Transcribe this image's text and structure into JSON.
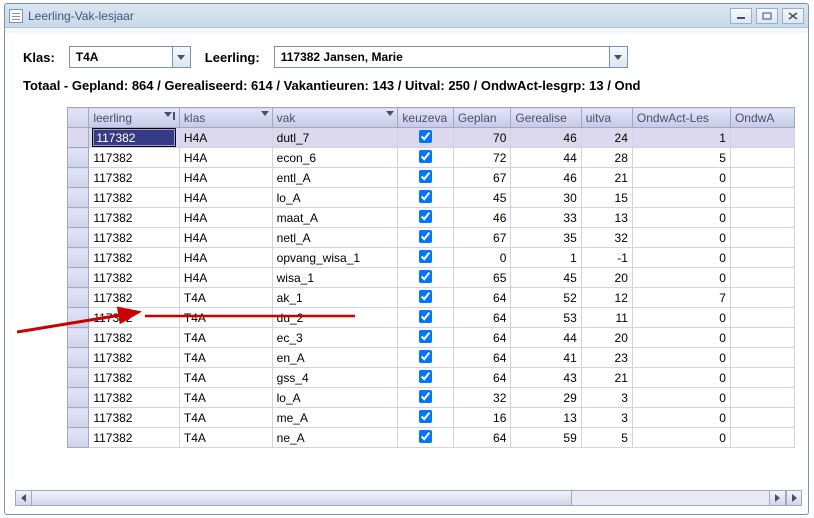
{
  "window": {
    "title": "Leerling-Vak-lesjaar"
  },
  "filters": {
    "klas_label": "Klas:",
    "klas_value": "T4A",
    "leerling_label": "Leerling:",
    "leerling_value": "117382 Jansen,  Marie"
  },
  "summary": "Totaal - Gepland: 864 / Gerealiseerd: 614 / Vakantieuren: 143 / Uitval: 250 / OndwAct-lesgrp: 13 / Ond",
  "columns": {
    "leerling": "leerling",
    "klas": "klas",
    "vak": "vak",
    "keuzeva": "keuzeva",
    "geplan": "Geplan",
    "gerealise": "Gerealise",
    "uitva": "uitva",
    "ondwact_les": "OndwAct-Les",
    "ondwa": "OndwA"
  },
  "rows": [
    {
      "leerling": "117382",
      "klas": "H4A",
      "vak": "dutl_7",
      "keuzeva": true,
      "geplan": "70",
      "gerealise": "46",
      "uitva": "24",
      "ondwact": "1",
      "ondwa": ""
    },
    {
      "leerling": "117382",
      "klas": "H4A",
      "vak": "econ_6",
      "keuzeva": true,
      "geplan": "72",
      "gerealise": "44",
      "uitva": "28",
      "ondwact": "5",
      "ondwa": ""
    },
    {
      "leerling": "117382",
      "klas": "H4A",
      "vak": "entl_A",
      "keuzeva": true,
      "geplan": "67",
      "gerealise": "46",
      "uitva": "21",
      "ondwact": "0",
      "ondwa": ""
    },
    {
      "leerling": "117382",
      "klas": "H4A",
      "vak": "lo_A",
      "keuzeva": true,
      "geplan": "45",
      "gerealise": "30",
      "uitva": "15",
      "ondwact": "0",
      "ondwa": ""
    },
    {
      "leerling": "117382",
      "klas": "H4A",
      "vak": "maat_A",
      "keuzeva": true,
      "geplan": "46",
      "gerealise": "33",
      "uitva": "13",
      "ondwact": "0",
      "ondwa": ""
    },
    {
      "leerling": "117382",
      "klas": "H4A",
      "vak": "netl_A",
      "keuzeva": true,
      "geplan": "67",
      "gerealise": "35",
      "uitva": "32",
      "ondwact": "0",
      "ondwa": ""
    },
    {
      "leerling": "117382",
      "klas": "H4A",
      "vak": "opvang_wisa_1",
      "keuzeva": true,
      "geplan": "0",
      "gerealise": "1",
      "uitva": "-1",
      "ondwact": "0",
      "ondwa": ""
    },
    {
      "leerling": "117382",
      "klas": "H4A",
      "vak": "wisa_1",
      "keuzeva": true,
      "geplan": "65",
      "gerealise": "45",
      "uitva": "20",
      "ondwact": "0",
      "ondwa": ""
    },
    {
      "leerling": "117382",
      "klas": "T4A",
      "vak": "ak_1",
      "keuzeva": true,
      "geplan": "64",
      "gerealise": "52",
      "uitva": "12",
      "ondwact": "7",
      "ondwa": ""
    },
    {
      "leerling": "117382",
      "klas": "T4A",
      "vak": "du_2",
      "keuzeva": true,
      "geplan": "64",
      "gerealise": "53",
      "uitva": "11",
      "ondwact": "0",
      "ondwa": ""
    },
    {
      "leerling": "117382",
      "klas": "T4A",
      "vak": "ec_3",
      "keuzeva": true,
      "geplan": "64",
      "gerealise": "44",
      "uitva": "20",
      "ondwact": "0",
      "ondwa": ""
    },
    {
      "leerling": "117382",
      "klas": "T4A",
      "vak": "en_A",
      "keuzeva": true,
      "geplan": "64",
      "gerealise": "41",
      "uitva": "23",
      "ondwact": "0",
      "ondwa": ""
    },
    {
      "leerling": "117382",
      "klas": "T4A",
      "vak": "gss_4",
      "keuzeva": true,
      "geplan": "64",
      "gerealise": "43",
      "uitva": "21",
      "ondwact": "0",
      "ondwa": ""
    },
    {
      "leerling": "117382",
      "klas": "T4A",
      "vak": "lo_A",
      "keuzeva": true,
      "geplan": "32",
      "gerealise": "29",
      "uitva": "3",
      "ondwact": "0",
      "ondwa": ""
    },
    {
      "leerling": "117382",
      "klas": "T4A",
      "vak": "me_A",
      "keuzeva": true,
      "geplan": "16",
      "gerealise": "13",
      "uitva": "3",
      "ondwact": "0",
      "ondwa": ""
    },
    {
      "leerling": "117382",
      "klas": "T4A",
      "vak": "ne_A",
      "keuzeva": true,
      "geplan": "64",
      "gerealise": "59",
      "uitva": "5",
      "ondwact": "0",
      "ondwa": ""
    }
  ]
}
